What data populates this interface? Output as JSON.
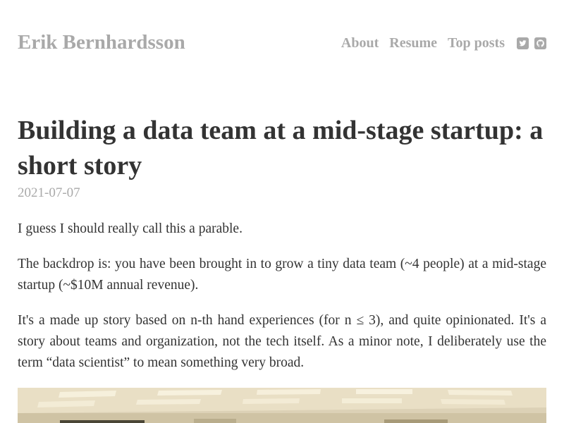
{
  "site": {
    "title": "Erik Bernhardsson"
  },
  "nav": {
    "items": [
      {
        "label": "About"
      },
      {
        "label": "Resume"
      },
      {
        "label": "Top posts"
      }
    ],
    "social": [
      {
        "icon": "twitter-icon"
      },
      {
        "icon": "github-icon"
      }
    ]
  },
  "post": {
    "title": "Building a data team at a mid-stage startup: a short story",
    "date": "2021-07-07",
    "paragraphs": [
      "I guess I should really call this a parable.",
      "The backdrop is: you have been brought in to grow a tiny data team (~4 people) at a mid-stage startup (~$10M annual revenue).",
      "It's a made up story based on n-th hand experiences (for n ≤ 3), and quite opinionated. It's a story about teams and organization, not the tech itself. As a minor note, I deliberately use the term “data scientist” to mean something very broad."
    ]
  },
  "colors": {
    "muted": "#a9a9a9",
    "text": "#333333",
    "background": "#ffffff"
  }
}
